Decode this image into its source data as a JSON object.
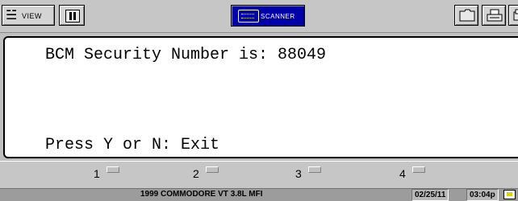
{
  "toolbar": {
    "view_label": "VIEW",
    "scanner_label": "SCANNER"
  },
  "display": {
    "line1": "BCM Security Number is: 88049",
    "line2": "Press Y or N: Exit"
  },
  "function_keys": [
    {
      "label": "1"
    },
    {
      "label": "2"
    },
    {
      "label": "3"
    },
    {
      "label": "4"
    }
  ],
  "status_bar": {
    "vehicle": "1999  COMMODORE VT 3.8L MFI",
    "date": "02/25/11",
    "time": "03:04p"
  }
}
